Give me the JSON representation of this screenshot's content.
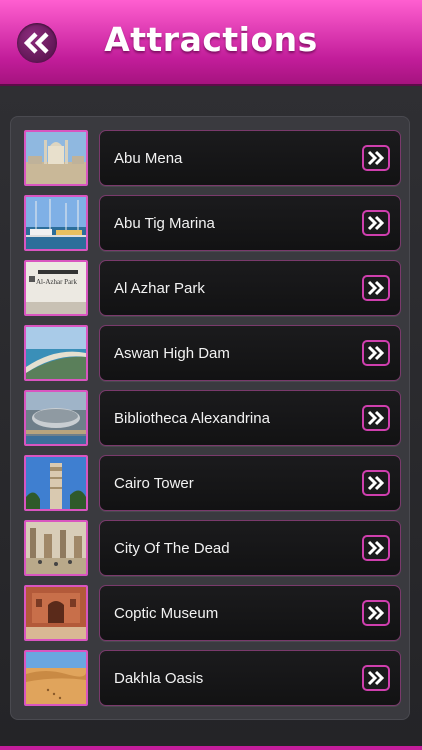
{
  "header": {
    "title": "Attractions",
    "back_icon": "double-chevron-left-icon",
    "accent": "#c21d9a"
  },
  "attractions": [
    {
      "name": "Abu Mena"
    },
    {
      "name": "Abu Tig Marina"
    },
    {
      "name": "Al Azhar Park",
      "thumb_caption": "Al-Azhar Park"
    },
    {
      "name": "Aswan High Dam"
    },
    {
      "name": "Bibliotheca Alexandrina"
    },
    {
      "name": "Cairo Tower"
    },
    {
      "name": "City Of The Dead"
    },
    {
      "name": "Coptic Museum"
    },
    {
      "name": "Dakhla Oasis"
    }
  ],
  "row_action_icon": "double-chevron-right-icon"
}
